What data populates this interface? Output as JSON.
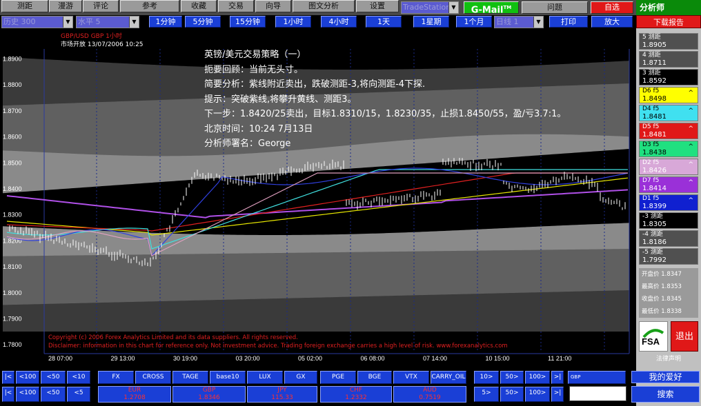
{
  "toolbar_top": {
    "buttons": [
      "测距",
      "漫游",
      "评论",
      "参考",
      "收藏",
      "交易",
      "向导",
      "图文分析",
      "设置"
    ],
    "tool_combo": "TradeStation",
    "gmail": "G-Mail",
    "gmail_tm": "TM",
    "help": "问题",
    "mine": "自选"
  },
  "toolbar_second": {
    "index_combo": "历史 300",
    "level_combo": "水平 5",
    "periods": [
      "1分钟",
      "5分钟",
      "15分钟",
      "1小时",
      "4小时",
      "1天",
      "1星期",
      "1个月"
    ],
    "mode_combo": "日线 1",
    "print": "打印",
    "zoom": "放大"
  },
  "chart": {
    "symbol": "GBP/USD  GBP 1小时",
    "market": "市场开放  13/07/2006 10:25",
    "strategy_lines": [
      "英镑/美元交易策略（一）",
      "扼要回顾：当前无头寸。",
      "简要分析：紫线附近卖出，跌破测距-3,将向测距-4下探.",
      "提示：突破紫线,将攀升黄线、测距3。",
      "下一步：1.8420/25卖出，目标1.8310/15，1.8230/35，止损1.8450/55，盈/亏3.7:1。",
      "北京时间：10:24  7月13日",
      "分析师署名：George"
    ],
    "copyright_1": "Copyright (c) 2006 Forex Analytics Limited and its data suppliers. All rights reserved.",
    "copyright_2": "Disclaimer: information in this chart for reference only. Not investment advice. Trading foreign exchange carries a high level of risk. www.forexanalytics.com",
    "y_ticks": [
      "1.7800",
      "1.7900",
      "1.8000",
      "1.8100",
      "1.8200",
      "1.8300",
      "1.8400",
      "1.8500",
      "1.8600",
      "1.8700",
      "1.8800",
      "1.8900"
    ],
    "x_ticks": [
      "28 07:00",
      "29 13:00",
      "30 19:00",
      "03 20:00",
      "05 02:00",
      "06 08:00",
      "07 14:00",
      "10 15:00",
      "11 21:00"
    ],
    "colors": {
      "purple": "#b050e8",
      "yellow": "#e8e800",
      "red": "#e02020",
      "cyan": "#40e0e0",
      "blue": "#3040e0",
      "pink": "#e0a0c0"
    }
  },
  "right_panel": {
    "header": "分析师",
    "download": "下载报告",
    "levels": [
      {
        "label": "5 测距",
        "value": "1.8905"
      },
      {
        "label": "4 测距",
        "value": "1.8711"
      },
      {
        "label": "3 测距",
        "value": "1.8592"
      },
      {
        "label": "D6 f5",
        "value": "1.8498"
      },
      {
        "label": "D4 f5",
        "value": "1.8481"
      },
      {
        "label": "D5 f5",
        "value": "1.8481"
      },
      {
        "label": "D3 f5",
        "value": "1.8438"
      },
      {
        "label": "D2 f5",
        "value": "1.8426"
      },
      {
        "label": "D7 f5",
        "value": "1.8414"
      },
      {
        "label": "D1 f5",
        "value": "1.8399"
      },
      {
        "label": "-3 测距",
        "value": "1.8305"
      },
      {
        "label": "-4 测距",
        "value": "1.8186"
      },
      {
        "label": "-5 测距",
        "value": "1.7992"
      }
    ],
    "ohlc": [
      {
        "label": "开盘价",
        "value": "1.8347"
      },
      {
        "label": "最高价",
        "value": "1.8353"
      },
      {
        "label": "收盘价",
        "value": "1.8345"
      },
      {
        "label": "最低价",
        "value": "1.8338"
      }
    ],
    "fsa": "FSA",
    "exit": "退出",
    "notice": "法律声明"
  },
  "bottom": {
    "nav_left_top": [
      "|<",
      "<100",
      "<50",
      "<10"
    ],
    "nav_left_bottom": [
      "|<",
      "<100",
      "<50",
      "<5"
    ],
    "indicators": [
      "FX",
      "CROSS",
      "TAGE",
      "base10",
      "LUX",
      "GX",
      "PGE",
      "BGE",
      "VTX",
      "CARRY_OIL"
    ],
    "quotes": [
      {
        "name": "EUR",
        "value": "1.2708"
      },
      {
        "name": "GBP",
        "value": "1.8346"
      },
      {
        "name": "JPY",
        "value": "115.33"
      },
      {
        "name": "CHF",
        "value": "1.2332"
      },
      {
        "name": "AUD",
        "value": "0.7519"
      }
    ],
    "nav_right_top": [
      "10>",
      "50>",
      "100>",
      ">|"
    ],
    "nav_right_bottom": [
      "5>",
      "50>",
      "100>",
      ">|"
    ],
    "input_label": "GBP",
    "favorite": "我的爱好",
    "search": "搜索"
  }
}
